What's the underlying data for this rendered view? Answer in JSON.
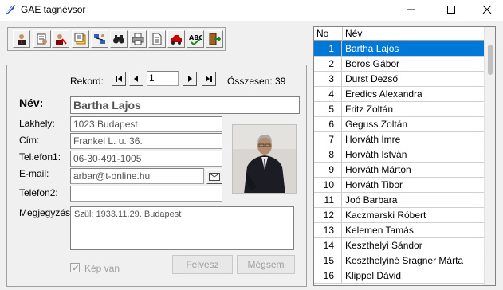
{
  "window": {
    "title": "GAE tagnévsor",
    "minimize": "–",
    "maximize": "☐",
    "close": "✕"
  },
  "toolbar": {
    "buttons": [
      "person-icon",
      "edit-list-icon",
      "delete-person-icon",
      "notes-icon",
      "network-icon",
      "binoculars-icon",
      "printer-icon",
      "document-icon",
      "car-icon",
      "spellcheck-icon",
      "exit-icon"
    ]
  },
  "nav": {
    "rekord_label": "Rekord:",
    "record_value": "1",
    "total_label": "Összesen: 39"
  },
  "form": {
    "nev_label": "Név:",
    "nev_value": "Bartha Lajos",
    "lakhely_label": "Lakhely:",
    "lakhely_value": "1023 Budapest",
    "cim_label": "Cím:",
    "cim_value": "Frankel L. u. 36.",
    "telefon1_label": "Tel.efon1:",
    "telefon1_value": "06-30-491-1005",
    "email_label": "E-mail:",
    "email_value": "arbar@t-online.hu",
    "telefon2_label": "Telefon2:",
    "telefon2_value": "",
    "megjegyzes_label": "Megjegyzés:",
    "megjegyzes_value": "Szül: 1933.11.29. Budapest",
    "kepvan_label": "Kép van",
    "kepvan_checked": true,
    "felvesz_label": "Felvesz",
    "megsem_label": "Mégsem"
  },
  "list": {
    "col_no": "No",
    "col_nev": "Név",
    "selected_index": 0,
    "rows": [
      {
        "no": "1",
        "nev": "Bartha Lajos"
      },
      {
        "no": "2",
        "nev": "Boros Gábor"
      },
      {
        "no": "3",
        "nev": "Durst Dezső"
      },
      {
        "no": "4",
        "nev": "Eredics Alexandra"
      },
      {
        "no": "5",
        "nev": "Fritz Zoltán"
      },
      {
        "no": "6",
        "nev": "Geguss Zoltán"
      },
      {
        "no": "7",
        "nev": "Horváth Imre"
      },
      {
        "no": "8",
        "nev": "Horváth István"
      },
      {
        "no": "9",
        "nev": "Horváth Márton"
      },
      {
        "no": "10",
        "nev": "Horváth Tibor"
      },
      {
        "no": "11",
        "nev": "Joó Barbara"
      },
      {
        "no": "12",
        "nev": "Kaczmarski Róbert"
      },
      {
        "no": "13",
        "nev": "Kelemen Tamás"
      },
      {
        "no": "14",
        "nev": "Keszthelyi Sándor"
      },
      {
        "no": "15",
        "nev": "Keszthelyiné Sragner Márta"
      },
      {
        "no": "16",
        "nev": "Klippel Dávid"
      }
    ]
  },
  "colors": {
    "selection": "#0078d7",
    "window_bg": "#f0f0f0"
  }
}
